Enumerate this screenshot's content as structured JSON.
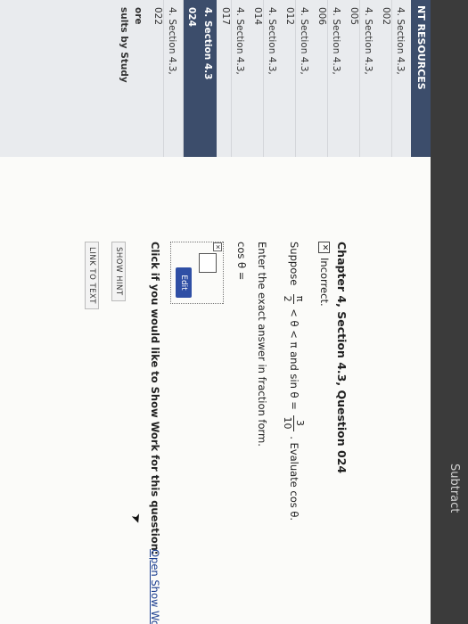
{
  "topbar": {
    "text": "Subtract"
  },
  "sidebar": {
    "header": "NT RESOURCES",
    "items": [
      {
        "label": "4. Section 4.3,",
        "sub": "002"
      },
      {
        "label": "4. Section 4.3,",
        "sub": "005"
      },
      {
        "label": "4. Section 4.3,",
        "sub": "006"
      },
      {
        "label": "4. Section 4.3,",
        "sub": "012"
      },
      {
        "label": "4. Section 4.3,",
        "sub": "014"
      },
      {
        "label": "4. Section 4.3,",
        "sub": "017"
      }
    ],
    "active": {
      "label": "4. Section 4.3",
      "sub": "024"
    },
    "after": {
      "label": "4. Section 4.3,",
      "sub": "022"
    },
    "more1": "ore",
    "more2": "sults by Study"
  },
  "question": {
    "title": "Chapter 4, Section 4.3, Question 024",
    "status": "Incorrect.",
    "prompt_start": "Suppose",
    "lower_num": "π",
    "lower_den": "2",
    "ineq": "< θ < π and sin θ =",
    "sin_num": "3",
    "sin_den": "10",
    "prompt_end": ". Evaluate cos θ.",
    "instruction": "Enter the exact answer in fraction form.",
    "answer_label": "cos θ =",
    "edit_label": "Edit",
    "work_prompt": "Click if you would like to Show Work for this question:",
    "work_link": "Open Show Work",
    "show_hint": "SHOW HINT",
    "link_to_text": "LINK TO TEXT"
  }
}
